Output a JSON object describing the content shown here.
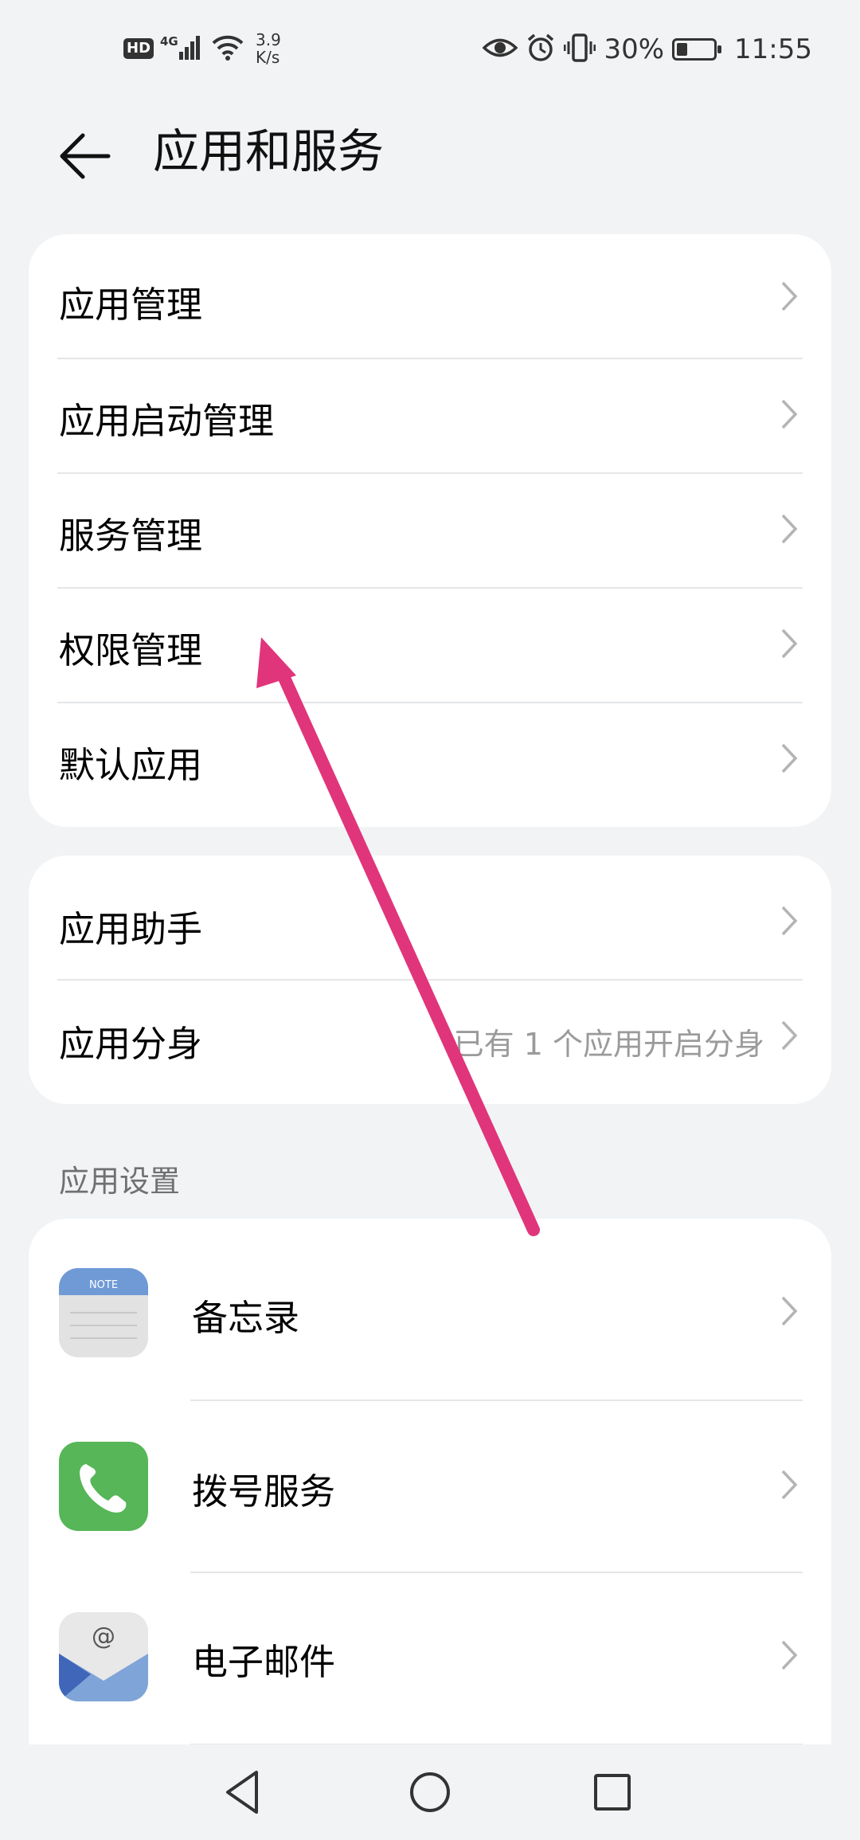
{
  "status_bar": {
    "hd": "HD",
    "network": "4G",
    "net_speed_value": "3.9",
    "net_speed_unit": "K/s",
    "battery_percent": "30%",
    "battery_level": 0.3,
    "time": "11:55"
  },
  "header": {
    "title": "应用和服务"
  },
  "group1": {
    "items": [
      {
        "label": "应用管理"
      },
      {
        "label": "应用启动管理"
      },
      {
        "label": "服务管理"
      },
      {
        "label": "权限管理"
      },
      {
        "label": "默认应用"
      }
    ]
  },
  "group2": {
    "items": [
      {
        "label": "应用助手"
      },
      {
        "label": "应用分身",
        "sub": "已有 1 个应用开启分身"
      }
    ]
  },
  "app_settings": {
    "section_title": "应用设置",
    "items": [
      {
        "label": "备忘录",
        "icon": "notepad-app-icon",
        "icon_text": "NOTE"
      },
      {
        "label": "拨号服务",
        "icon": "phone-app-icon"
      },
      {
        "label": "电子邮件",
        "icon": "email-app-icon",
        "icon_text": "@"
      }
    ]
  },
  "colors": {
    "background": "#f1f3f5",
    "card": "#ffffff",
    "annotation_arrow": "#e0357a",
    "phone_icon": "#56b658",
    "note_icon": "#6f9ad6",
    "email_icon": "#7fa4d8"
  }
}
